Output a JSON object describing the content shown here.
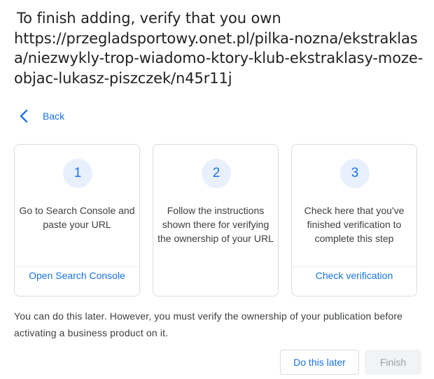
{
  "header": {
    "title_lead": "To finish adding, verify that you own",
    "title_url": "https://przegladsportowy.onet.pl/pilka-nozna/ekstraklasa/niezwykly-trop-wiadomo-ktory-klub-ekstraklasy-moze-objac-lukasz-piszczek/n45r11j"
  },
  "nav": {
    "back_label": "Back",
    "back_icon": "chevron-left-icon"
  },
  "steps": [
    {
      "number": "1",
      "text": "Go to Search Console and paste your URL",
      "action": "Open Search Console"
    },
    {
      "number": "2",
      "text": "Follow the instructions shown there for verifying the ownership of your URL",
      "action": ""
    },
    {
      "number": "3",
      "text": "Check here that you've finished verification to complete this step",
      "action": "Check verification"
    }
  ],
  "note": "You can do this later. However, you must verify the ownership of your publication before activating a business product on it.",
  "footer": {
    "later_label": "Do this later",
    "finish_label": "Finish"
  },
  "colors": {
    "accent": "#1a73e8",
    "step_circle_bg": "#e8f0fe",
    "border": "#dadce0",
    "disabled_bg": "#f1f3f4",
    "disabled_text": "#9aa0a6"
  }
}
